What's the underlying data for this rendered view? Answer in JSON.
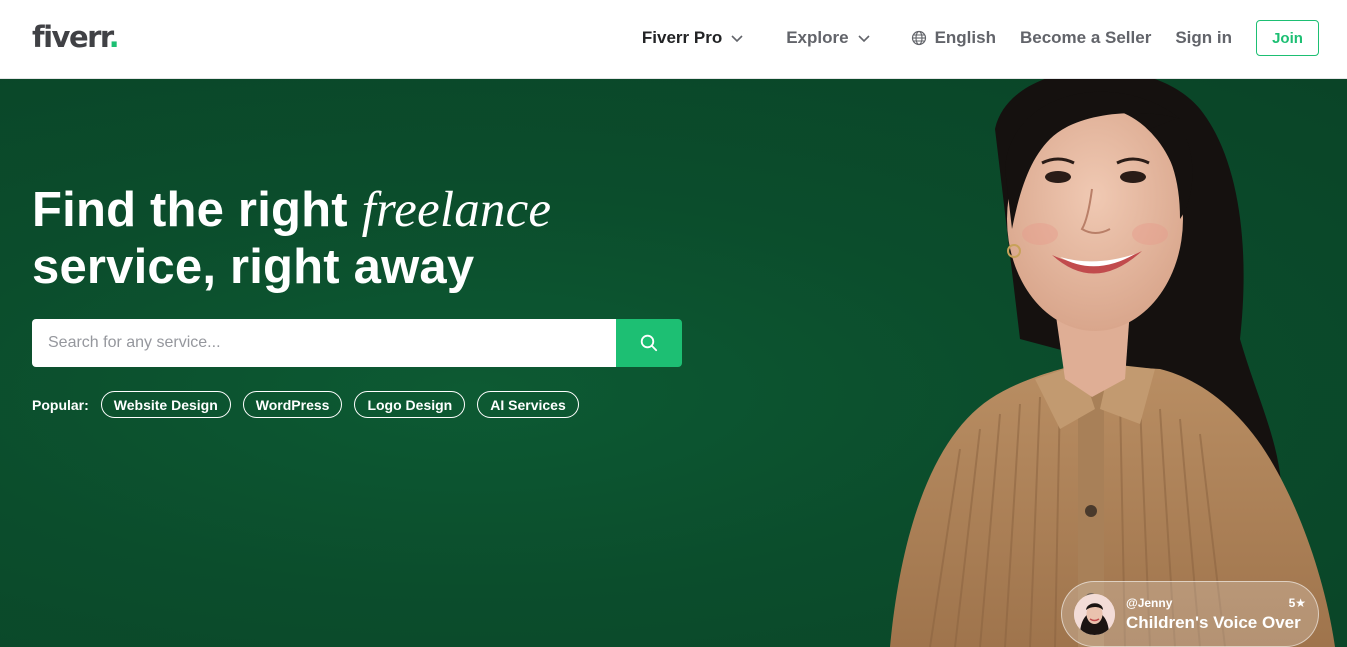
{
  "header": {
    "logo_text": "fiverr",
    "logo_dot": ".",
    "nav": {
      "fiverr_pro": "Fiverr Pro",
      "explore": "Explore",
      "language": "English",
      "become_seller": "Become a Seller",
      "sign_in": "Sign in",
      "join": "Join"
    }
  },
  "hero": {
    "headline_part1": "Find the right ",
    "headline_italic": "freelance",
    "headline_part2": "service, right away",
    "search": {
      "placeholder": "Search for any service...",
      "value": ""
    },
    "popular": {
      "label": "Popular:",
      "items": [
        "Website Design",
        "WordPress",
        "Logo Design",
        "AI Services"
      ]
    },
    "seller_card": {
      "handle": "@Jenny",
      "rating": "5★",
      "service": "Children's Voice Over"
    }
  },
  "colors": {
    "brand_green": "#1dbf73",
    "hero_background": "#0b4d2c",
    "text_dark": "#222325",
    "text_gray": "#62646a"
  },
  "icons": [
    "chevron-down-icon",
    "globe-icon",
    "search-icon"
  ]
}
